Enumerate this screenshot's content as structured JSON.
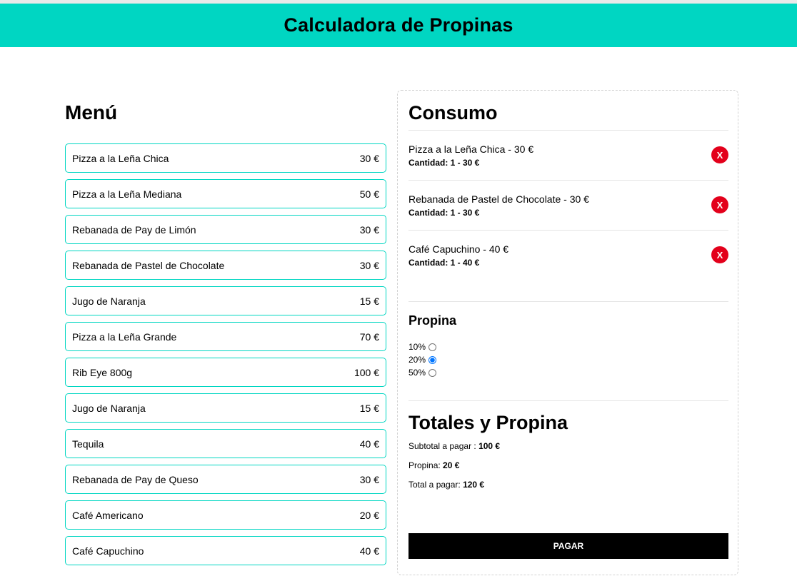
{
  "header": {
    "title": "Calculadora de Propinas"
  },
  "menu": {
    "title": "Menú",
    "items": [
      {
        "name": "Pizza a la Leña Chica",
        "price": "30 €"
      },
      {
        "name": "Pizza a la Leña Mediana",
        "price": "50 €"
      },
      {
        "name": "Rebanada de Pay de Limón",
        "price": "30 €"
      },
      {
        "name": "Rebanada de Pastel de Chocolate",
        "price": "30 €"
      },
      {
        "name": "Jugo de Naranja",
        "price": "15 €"
      },
      {
        "name": "Pizza a la Leña Grande",
        "price": "70 €"
      },
      {
        "name": "Rib Eye 800g",
        "price": "100 €"
      },
      {
        "name": "Jugo de Naranja",
        "price": "15 €"
      },
      {
        "name": "Tequila",
        "price": "40 €"
      },
      {
        "name": "Rebanada de Pay de Queso",
        "price": "30 €"
      },
      {
        "name": "Café Americano",
        "price": "20 €"
      },
      {
        "name": "Café Capuchino",
        "price": "40 €"
      }
    ]
  },
  "consumo": {
    "title": "Consumo",
    "items": [
      {
        "name": "Pizza a la Leña Chica - 30 €",
        "qty": "Cantidad: 1 - 30 €",
        "remove_label": "X"
      },
      {
        "name": "Rebanada de Pastel de Chocolate - 30 €",
        "qty": "Cantidad: 1 - 30 €",
        "remove_label": "X"
      },
      {
        "name": "Café Capuchino - 40 €",
        "qty": "Cantidad: 1 - 40 €",
        "remove_label": "X"
      }
    ]
  },
  "propina": {
    "title": "Propina",
    "options": [
      {
        "label": "10%",
        "checked": false
      },
      {
        "label": "20%",
        "checked": true
      },
      {
        "label": "50%",
        "checked": false
      }
    ]
  },
  "totales": {
    "title": "Totales y Propina",
    "subtotal_label": "Subtotal a pagar : ",
    "subtotal_value": "100 €",
    "propina_label": "Propina: ",
    "propina_value": "20 €",
    "total_label": "Total a pagar: ",
    "total_value": "120 €"
  },
  "pay_button": "PAGAR",
  "colors": {
    "accent": "#00d6c2",
    "remove": "#e3001b",
    "button": "#000000"
  }
}
